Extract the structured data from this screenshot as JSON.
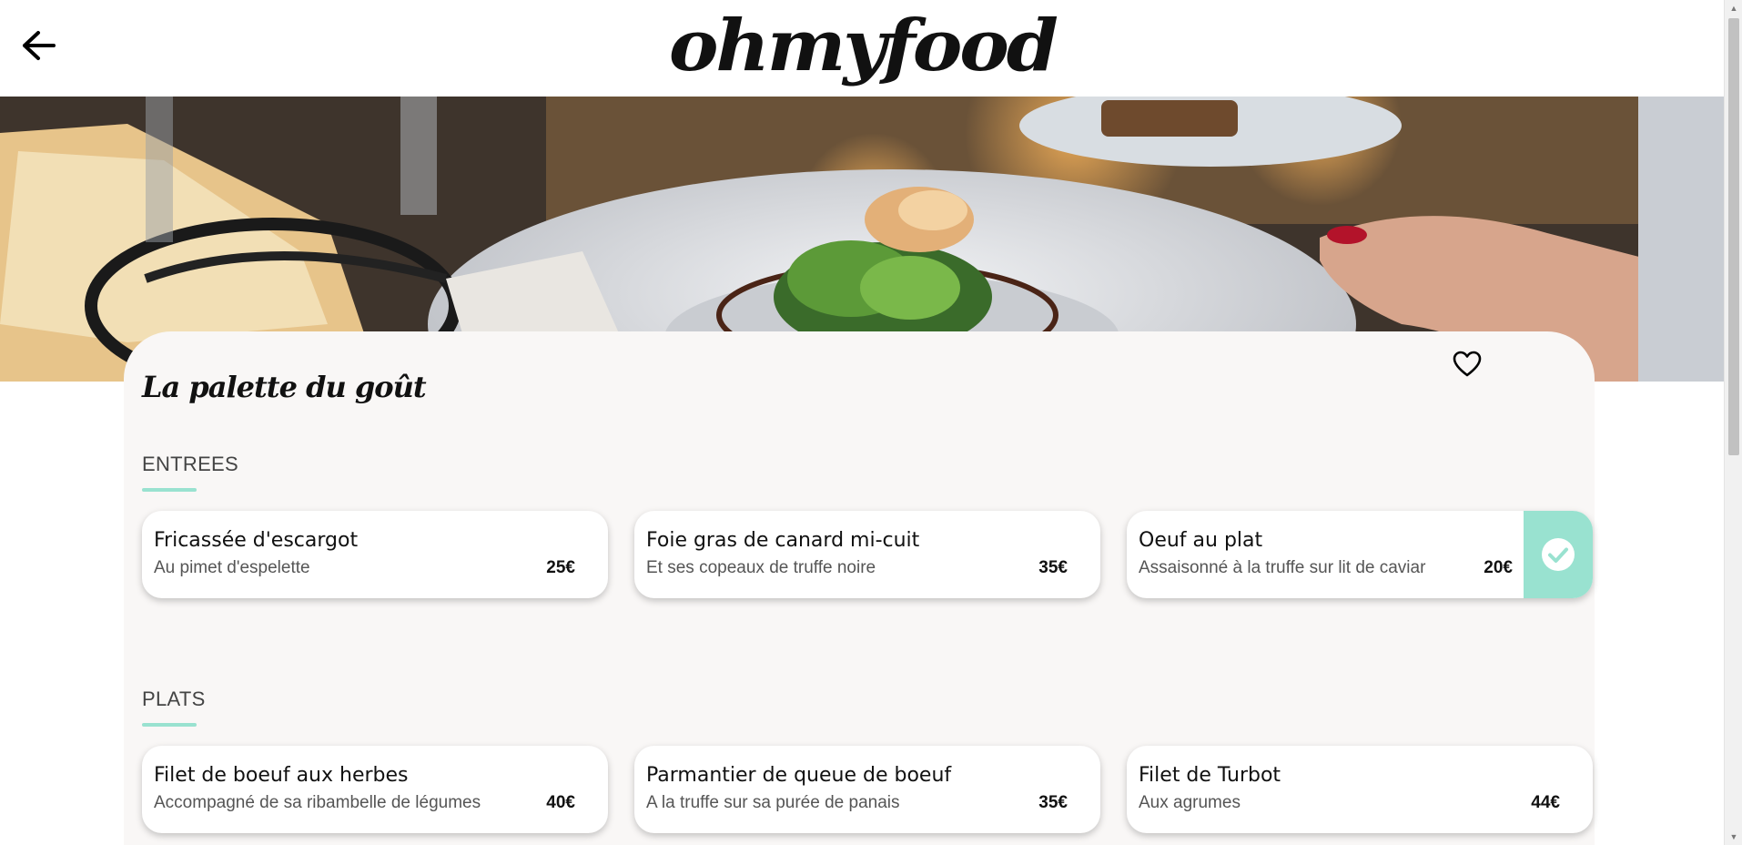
{
  "header": {
    "logo": "ohmyfood",
    "back_icon": "arrow-left-icon"
  },
  "restaurant": {
    "name": "La palette du goût",
    "favorite_icon": "heart-icon"
  },
  "sections": [
    {
      "title": "ENTREES",
      "dishes": [
        {
          "name": "Fricassée d'escargot",
          "description": "Au pimet d'espelette",
          "price": "25€",
          "selected": false
        },
        {
          "name": "Foie gras de canard mi-cuit",
          "description": "Et ses copeaux de truffe noire",
          "price": "35€",
          "selected": false
        },
        {
          "name": "Oeuf au plat",
          "description": "Assaisonné à la truffe sur lit de caviar",
          "price": "20€",
          "selected": true
        }
      ]
    },
    {
      "title": "PLATS",
      "dishes": [
        {
          "name": "Filet de boeuf aux herbes",
          "description": "Accompagné de sa ribambelle de légumes",
          "price": "40€",
          "selected": false
        },
        {
          "name": "Parmantier de queue de boeuf",
          "description": "A la truffe sur sa purée de panais",
          "price": "35€",
          "selected": false
        },
        {
          "name": "Filet de Turbot",
          "description": "Aux agrumes",
          "price": "44€",
          "selected": false
        }
      ]
    }
  ],
  "colors": {
    "accent": "#99e2d0",
    "panel": "#f9f7f6"
  }
}
